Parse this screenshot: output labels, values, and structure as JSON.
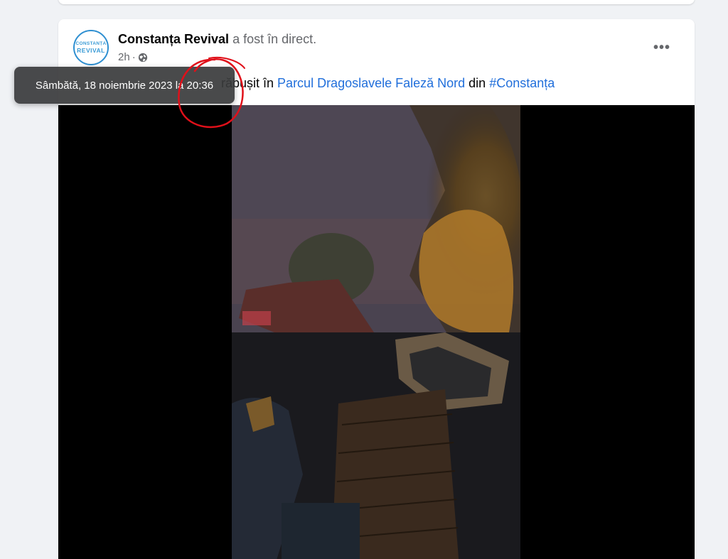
{
  "post": {
    "author": "Constanța Revival",
    "status": "a fost în direct.",
    "time": "2h",
    "separator": "·",
    "more_label": "•••",
    "avatar_text_top": "CONSTANȚA",
    "avatar_text_bottom": "REVIVAL",
    "text_visible_start": "răbușit în ",
    "place_link": "Parcul Dragoslavele Faleză Nord",
    "text_mid": " din ",
    "hashtag": "#Constanța"
  },
  "tooltip": {
    "text": "Sâmbătă, 18 noiembrie 2023 la 20:36"
  },
  "annotation": {
    "circle_color": "#e0101a"
  },
  "colors": {
    "link": "#216fdb",
    "page_bg": "#f0f2f5",
    "card_bg": "#ffffff"
  },
  "icons": {
    "privacy": "globe-icon",
    "more": "more-options-icon"
  }
}
